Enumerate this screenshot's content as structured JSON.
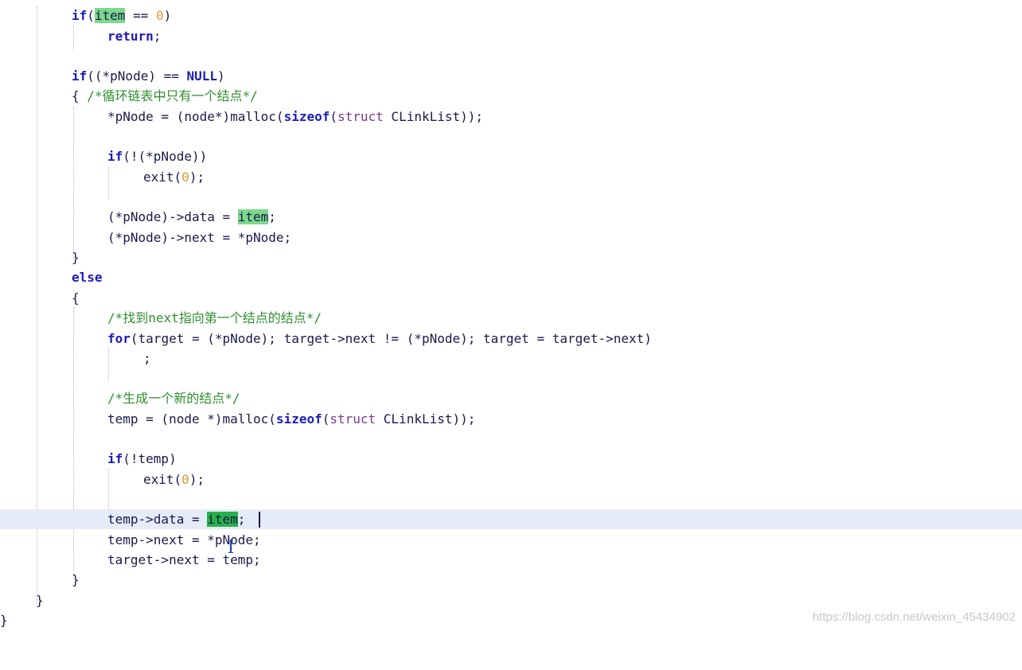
{
  "editor": {
    "lines": [
      {
        "text": "if(item == 0)"
      },
      {
        "text": "return;"
      },
      {
        "text": "if((*pNode) == NULL)"
      },
      {
        "text": "{ /*循环链表中只有一个结点*/"
      },
      {
        "text": "*pNode = (node*)malloc(sizeof(struct CLinkList));"
      },
      {
        "text": "if(!(*pNode))"
      },
      {
        "text": "exit(0);"
      },
      {
        "text": "(*pNode)->data = item;"
      },
      {
        "text": "(*pNode)->next = *pNode;"
      },
      {
        "text": "}"
      },
      {
        "text": "else"
      },
      {
        "text": "{"
      },
      {
        "text": "/*找到next指向第一个结点的结点*/"
      },
      {
        "text": "for(target = (*pNode); target->next != (*pNode); target = target->next)"
      },
      {
        "text": ";"
      },
      {
        "text": "/*生成一个新的结点*/"
      },
      {
        "text": "temp = (node *)malloc(sizeof(struct CLinkList));"
      },
      {
        "text": "if(!temp)"
      },
      {
        "text": "exit(0);"
      },
      {
        "text": "temp->data = item;"
      },
      {
        "text": "temp->next = *pNode;"
      },
      {
        "text": "target->next = temp;"
      },
      {
        "text": "}"
      },
      {
        "text": "}"
      },
      {
        "text": "}"
      }
    ],
    "current_line": 20,
    "highlighted_word": "item"
  },
  "cursor_icon": "text-ibeam-icon",
  "watermark": "https://blog.csdn.net/weixin_45434902",
  "colors": {
    "keyword": "#1b1bb8",
    "number": "#d89a3a",
    "comment": "#2f8f2f",
    "type": "#7a3b8e",
    "highlight": "#7ad98b",
    "current_line": "#e6ebf8"
  }
}
